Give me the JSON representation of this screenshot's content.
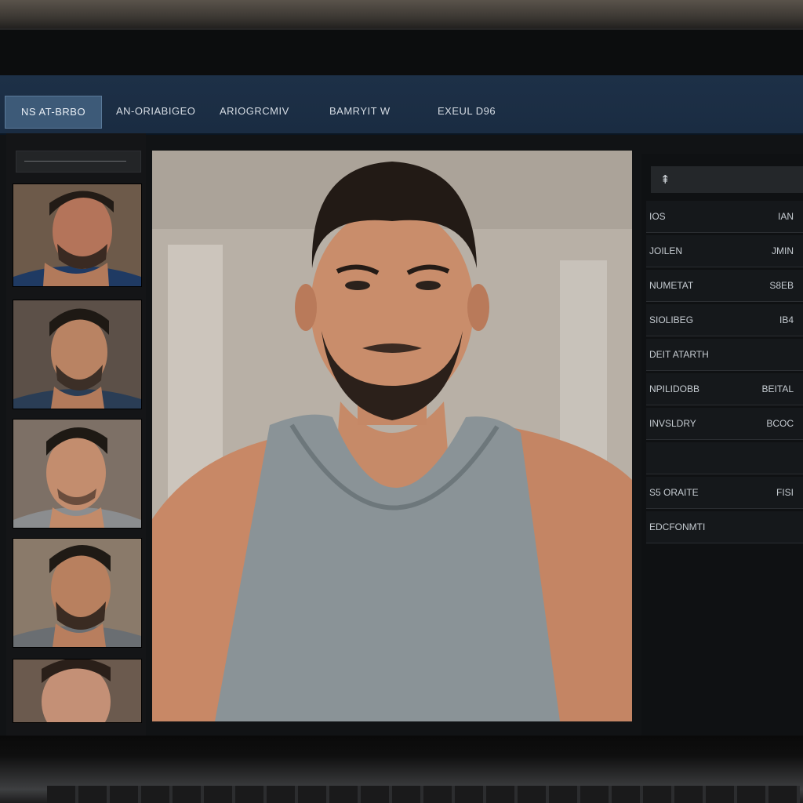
{
  "tabs": [
    {
      "label": "NS AT-BRBO",
      "active": true
    },
    {
      "label": "AN-ORIABIGEO",
      "active": false
    },
    {
      "label": "ARIOGRCMIV",
      "active": false
    },
    {
      "label": "BAMRYIT W",
      "active": false
    },
    {
      "label": "EXEUL D96",
      "active": false
    }
  ],
  "right_panel": {
    "header_icon": "pin-icon",
    "header_glyph": "⇞",
    "rows": [
      {
        "key": "IOS",
        "value": "IAN"
      },
      {
        "key": "JOILEN",
        "value": "JMIN"
      },
      {
        "key": "NUMETAT",
        "value": "S8EB"
      },
      {
        "key": "SIOLIBEG",
        "value": "IB4"
      },
      {
        "key": "DEIT ATARTH",
        "value": ""
      },
      {
        "key": "NPILIDOBB",
        "value": "BEITAL"
      },
      {
        "key": "INVSLDRY",
        "value": "BCOC"
      },
      {
        "key": "",
        "value": ""
      },
      {
        "key": "S5 ORAITE",
        "value": "FISI"
      },
      {
        "key": "EDCFONMTI",
        "value": ""
      }
    ]
  },
  "colors": {
    "topbar": "#1d3047",
    "active_tab": "#3d5a78",
    "panel": "#15181b"
  }
}
